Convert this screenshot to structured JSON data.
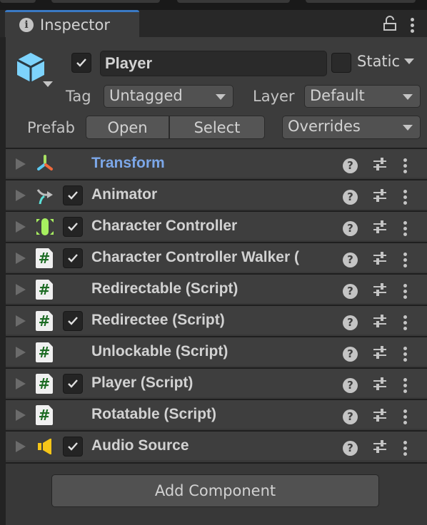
{
  "window": {
    "tab_label": "Inspector",
    "tab_icon": "info-icon",
    "lock_icon": "unlock-icon",
    "menu_icon": "kebab-menu-icon",
    "accent_color": "#3a79c4"
  },
  "gameobject": {
    "icon": "cube-icon",
    "active": true,
    "name": "Player",
    "static_checked": false,
    "static_label": "Static",
    "tag_label": "Tag",
    "tag_value": "Untagged",
    "layer_label": "Layer",
    "layer_value": "Default",
    "prefab_label": "Prefab",
    "prefab_open": "Open",
    "prefab_select": "Select",
    "prefab_overrides": "Overrides"
  },
  "components": [
    {
      "name": "Transform",
      "icon": "transform-icon",
      "has_checkbox": false,
      "enabled": null
    },
    {
      "name": "Animator",
      "icon": "animator-icon",
      "has_checkbox": true,
      "enabled": true
    },
    {
      "name": "Character Controller",
      "icon": "character-controller-icon",
      "has_checkbox": true,
      "enabled": true
    },
    {
      "name": "Character Controller Walker (",
      "icon": "script-icon",
      "has_checkbox": true,
      "enabled": true
    },
    {
      "name": "Redirectable (Script)",
      "icon": "script-icon",
      "has_checkbox": false,
      "enabled": null
    },
    {
      "name": "Redirectee (Script)",
      "icon": "script-icon",
      "has_checkbox": true,
      "enabled": true
    },
    {
      "name": "Unlockable (Script)",
      "icon": "script-icon",
      "has_checkbox": false,
      "enabled": null
    },
    {
      "name": "Player (Script)",
      "icon": "script-icon",
      "has_checkbox": true,
      "enabled": true
    },
    {
      "name": "Rotatable (Script)",
      "icon": "script-icon",
      "has_checkbox": false,
      "enabled": null
    },
    {
      "name": "Audio Source",
      "icon": "audio-source-icon",
      "has_checkbox": true,
      "enabled": true
    }
  ],
  "component_actions": {
    "help": "?",
    "help_icon": "help-icon",
    "preset_icon": "preset-icon",
    "menu_icon": "kebab-menu-icon"
  },
  "script_glyph": "#",
  "add_component_label": "Add Component"
}
